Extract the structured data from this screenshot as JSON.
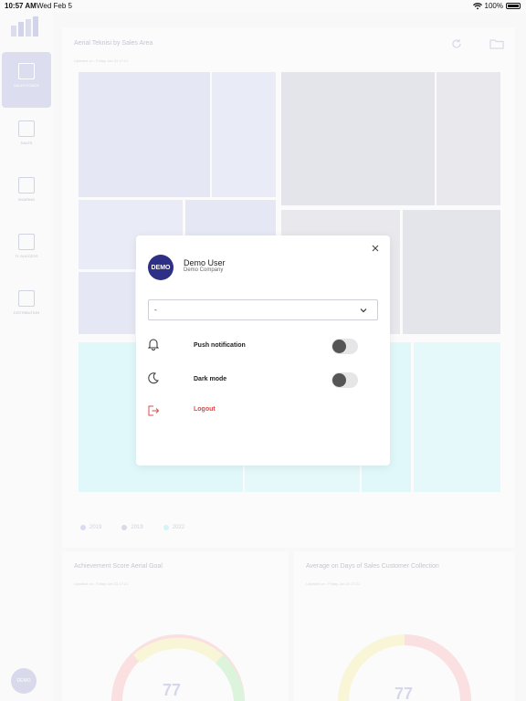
{
  "status_bar": {
    "time": "10:57 AM",
    "date": "Wed Feb 5",
    "battery": "100%"
  },
  "sidebar": {
    "items": [
      {
        "label": "SALES FORCE",
        "active": true
      },
      {
        "label": "SALES",
        "active": false
      },
      {
        "label": "SHARING",
        "active": false
      },
      {
        "label": "TL SUCCESS",
        "active": false
      },
      {
        "label": "DISTRIBUTION",
        "active": false
      }
    ],
    "avatar": "DEMO"
  },
  "background": {
    "treemap_title": "Aerial Teknisi by Sales Area",
    "treemap_sub": "Updated on : Friday Jan 31 17:21",
    "legend": [
      "2019",
      "2019",
      "2022"
    ],
    "gauge_left_title": "Achievement Score Aerial Goal",
    "gauge_left_sub": "Updated on : Friday Jan 31 17:21",
    "gauge_left_value": "77",
    "gauge_right_title": "Average on Days of Sales Customer Collection",
    "gauge_right_sub": "Updated on : Friday Jan 31 17:21",
    "gauge_right_value": "77"
  },
  "modal": {
    "avatar": "DEMO",
    "user_name": "Demo User",
    "company": "Demo Company",
    "select_value": "-",
    "push_label": "Push notification",
    "push_enabled": false,
    "dark_label": "Dark mode",
    "dark_enabled": false,
    "logout_label": "Logout"
  },
  "colors": {
    "accent": "#2e2f86",
    "logout": "#e04848"
  }
}
